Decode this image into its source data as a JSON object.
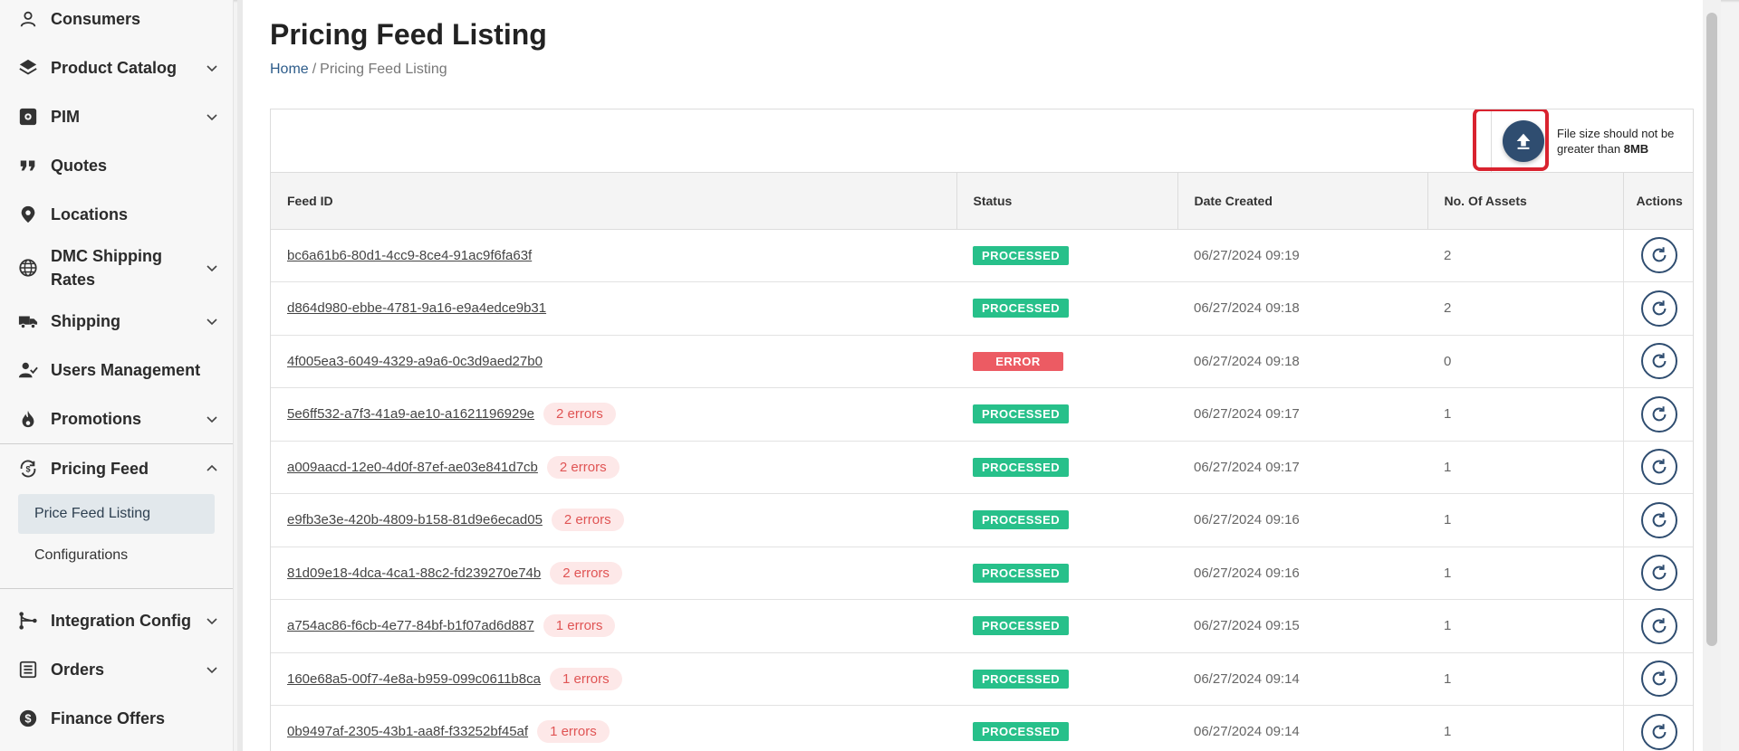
{
  "sidebar": {
    "items": [
      {
        "label": "Consumers",
        "icon": "user-icon",
        "chevron": false
      },
      {
        "label": "Product Catalog",
        "icon": "layers-icon",
        "chevron": true
      },
      {
        "label": "PIM",
        "icon": "gear-box-icon",
        "chevron": true
      },
      {
        "label": "Quotes",
        "icon": "quote-icon",
        "chevron": false
      },
      {
        "label": "Locations",
        "icon": "map-pin-icon",
        "chevron": false
      },
      {
        "label": "DMC Shipping Rates",
        "icon": "globe-icon",
        "chevron": true
      },
      {
        "label": "Shipping",
        "icon": "truck-icon",
        "chevron": true
      },
      {
        "label": "Users Management",
        "icon": "user-check-icon",
        "chevron": false
      },
      {
        "label": "Promotions",
        "icon": "flame-icon",
        "chevron": true
      }
    ],
    "open_section": {
      "label": "Pricing Feed",
      "icon": "dollar-cycle-icon",
      "sub_items": [
        {
          "label": "Price Feed Listing",
          "active": true
        },
        {
          "label": "Configurations",
          "active": false
        }
      ]
    },
    "items_after": [
      {
        "label": "Integration Config",
        "icon": "branch-icon",
        "chevron": true
      },
      {
        "label": "Orders",
        "icon": "list-icon",
        "chevron": true
      },
      {
        "label": "Finance Offers",
        "icon": "dollar-circle-icon",
        "chevron": false
      }
    ]
  },
  "page": {
    "title": "Pricing Feed Listing",
    "breadcrumb": {
      "home": "Home",
      "separator": "/",
      "current": "Pricing Feed Listing"
    }
  },
  "upload": {
    "note_prefix": "File size should not be greater than",
    "note_size": "8MB"
  },
  "table": {
    "columns": [
      "Feed ID",
      "Status",
      "Date Created",
      "No. Of Assets",
      "Actions"
    ],
    "rows": [
      {
        "feed_id": "bc6a61b6-80d1-4cc9-8ce4-91ac9f6fa63f",
        "errors": "",
        "status": "PROCESSED",
        "date": "06/27/2024 09:19",
        "assets": "2"
      },
      {
        "feed_id": "d864d980-ebbe-4781-9a16-e9a4edce9b31",
        "errors": "",
        "status": "PROCESSED",
        "date": "06/27/2024 09:18",
        "assets": "2"
      },
      {
        "feed_id": "4f005ea3-6049-4329-a9a6-0c3d9aed27b0",
        "errors": "",
        "status": "ERROR",
        "date": "06/27/2024 09:18",
        "assets": "0"
      },
      {
        "feed_id": "5e6ff532-a7f3-41a9-ae10-a1621196929e",
        "errors": "2 errors",
        "status": "PROCESSED",
        "date": "06/27/2024 09:17",
        "assets": "1"
      },
      {
        "feed_id": "a009aacd-12e0-4d0f-87ef-ae03e841d7cb",
        "errors": "2 errors",
        "status": "PROCESSED",
        "date": "06/27/2024 09:17",
        "assets": "1"
      },
      {
        "feed_id": "e9fb3e3e-420b-4809-b158-81d9e6ecad05",
        "errors": "2 errors",
        "status": "PROCESSED",
        "date": "06/27/2024 09:16",
        "assets": "1"
      },
      {
        "feed_id": "81d09e18-4dca-4ca1-88c2-fd239270e74b",
        "errors": "2 errors",
        "status": "PROCESSED",
        "date": "06/27/2024 09:16",
        "assets": "1"
      },
      {
        "feed_id": "a754ac86-f6cb-4e77-84bf-b1f07ad6d887",
        "errors": "1 errors",
        "status": "PROCESSED",
        "date": "06/27/2024 09:15",
        "assets": "1"
      },
      {
        "feed_id": "160e68a5-00f7-4e8a-b959-099c0611b8ca",
        "errors": "1 errors",
        "status": "PROCESSED",
        "date": "06/27/2024 09:14",
        "assets": "1"
      },
      {
        "feed_id": "0b9497af-2305-43b1-aa8f-f33252bf45af",
        "errors": "1 errors",
        "status": "PROCESSED",
        "date": "06/27/2024 09:14",
        "assets": "1"
      }
    ]
  },
  "colors": {
    "processed": "#27c08a",
    "error": "#ec5b63",
    "accent": "#2f4d70",
    "highlight": "#d9232f"
  }
}
